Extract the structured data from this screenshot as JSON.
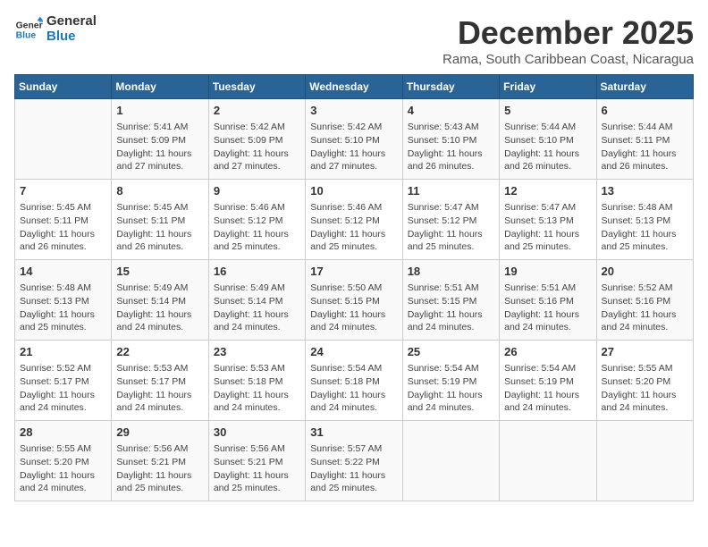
{
  "logo": {
    "line1": "General",
    "line2": "Blue"
  },
  "title": "December 2025",
  "subtitle": "Rama, South Caribbean Coast, Nicaragua",
  "days_of_week": [
    "Sunday",
    "Monday",
    "Tuesday",
    "Wednesday",
    "Thursday",
    "Friday",
    "Saturday"
  ],
  "weeks": [
    [
      {
        "day": "",
        "info": ""
      },
      {
        "day": "1",
        "info": "Sunrise: 5:41 AM\nSunset: 5:09 PM\nDaylight: 11 hours\nand 27 minutes."
      },
      {
        "day": "2",
        "info": "Sunrise: 5:42 AM\nSunset: 5:09 PM\nDaylight: 11 hours\nand 27 minutes."
      },
      {
        "day": "3",
        "info": "Sunrise: 5:42 AM\nSunset: 5:10 PM\nDaylight: 11 hours\nand 27 minutes."
      },
      {
        "day": "4",
        "info": "Sunrise: 5:43 AM\nSunset: 5:10 PM\nDaylight: 11 hours\nand 26 minutes."
      },
      {
        "day": "5",
        "info": "Sunrise: 5:44 AM\nSunset: 5:10 PM\nDaylight: 11 hours\nand 26 minutes."
      },
      {
        "day": "6",
        "info": "Sunrise: 5:44 AM\nSunset: 5:11 PM\nDaylight: 11 hours\nand 26 minutes."
      }
    ],
    [
      {
        "day": "7",
        "info": "Sunrise: 5:45 AM\nSunset: 5:11 PM\nDaylight: 11 hours\nand 26 minutes."
      },
      {
        "day": "8",
        "info": "Sunrise: 5:45 AM\nSunset: 5:11 PM\nDaylight: 11 hours\nand 26 minutes."
      },
      {
        "day": "9",
        "info": "Sunrise: 5:46 AM\nSunset: 5:12 PM\nDaylight: 11 hours\nand 25 minutes."
      },
      {
        "day": "10",
        "info": "Sunrise: 5:46 AM\nSunset: 5:12 PM\nDaylight: 11 hours\nand 25 minutes."
      },
      {
        "day": "11",
        "info": "Sunrise: 5:47 AM\nSunset: 5:12 PM\nDaylight: 11 hours\nand 25 minutes."
      },
      {
        "day": "12",
        "info": "Sunrise: 5:47 AM\nSunset: 5:13 PM\nDaylight: 11 hours\nand 25 minutes."
      },
      {
        "day": "13",
        "info": "Sunrise: 5:48 AM\nSunset: 5:13 PM\nDaylight: 11 hours\nand 25 minutes."
      }
    ],
    [
      {
        "day": "14",
        "info": "Sunrise: 5:48 AM\nSunset: 5:13 PM\nDaylight: 11 hours\nand 25 minutes."
      },
      {
        "day": "15",
        "info": "Sunrise: 5:49 AM\nSunset: 5:14 PM\nDaylight: 11 hours\nand 24 minutes."
      },
      {
        "day": "16",
        "info": "Sunrise: 5:49 AM\nSunset: 5:14 PM\nDaylight: 11 hours\nand 24 minutes."
      },
      {
        "day": "17",
        "info": "Sunrise: 5:50 AM\nSunset: 5:15 PM\nDaylight: 11 hours\nand 24 minutes."
      },
      {
        "day": "18",
        "info": "Sunrise: 5:51 AM\nSunset: 5:15 PM\nDaylight: 11 hours\nand 24 minutes."
      },
      {
        "day": "19",
        "info": "Sunrise: 5:51 AM\nSunset: 5:16 PM\nDaylight: 11 hours\nand 24 minutes."
      },
      {
        "day": "20",
        "info": "Sunrise: 5:52 AM\nSunset: 5:16 PM\nDaylight: 11 hours\nand 24 minutes."
      }
    ],
    [
      {
        "day": "21",
        "info": "Sunrise: 5:52 AM\nSunset: 5:17 PM\nDaylight: 11 hours\nand 24 minutes."
      },
      {
        "day": "22",
        "info": "Sunrise: 5:53 AM\nSunset: 5:17 PM\nDaylight: 11 hours\nand 24 minutes."
      },
      {
        "day": "23",
        "info": "Sunrise: 5:53 AM\nSunset: 5:18 PM\nDaylight: 11 hours\nand 24 minutes."
      },
      {
        "day": "24",
        "info": "Sunrise: 5:54 AM\nSunset: 5:18 PM\nDaylight: 11 hours\nand 24 minutes."
      },
      {
        "day": "25",
        "info": "Sunrise: 5:54 AM\nSunset: 5:19 PM\nDaylight: 11 hours\nand 24 minutes."
      },
      {
        "day": "26",
        "info": "Sunrise: 5:54 AM\nSunset: 5:19 PM\nDaylight: 11 hours\nand 24 minutes."
      },
      {
        "day": "27",
        "info": "Sunrise: 5:55 AM\nSunset: 5:20 PM\nDaylight: 11 hours\nand 24 minutes."
      }
    ],
    [
      {
        "day": "28",
        "info": "Sunrise: 5:55 AM\nSunset: 5:20 PM\nDaylight: 11 hours\nand 24 minutes."
      },
      {
        "day": "29",
        "info": "Sunrise: 5:56 AM\nSunset: 5:21 PM\nDaylight: 11 hours\nand 25 minutes."
      },
      {
        "day": "30",
        "info": "Sunrise: 5:56 AM\nSunset: 5:21 PM\nDaylight: 11 hours\nand 25 minutes."
      },
      {
        "day": "31",
        "info": "Sunrise: 5:57 AM\nSunset: 5:22 PM\nDaylight: 11 hours\nand 25 minutes."
      },
      {
        "day": "",
        "info": ""
      },
      {
        "day": "",
        "info": ""
      },
      {
        "day": "",
        "info": ""
      }
    ]
  ]
}
